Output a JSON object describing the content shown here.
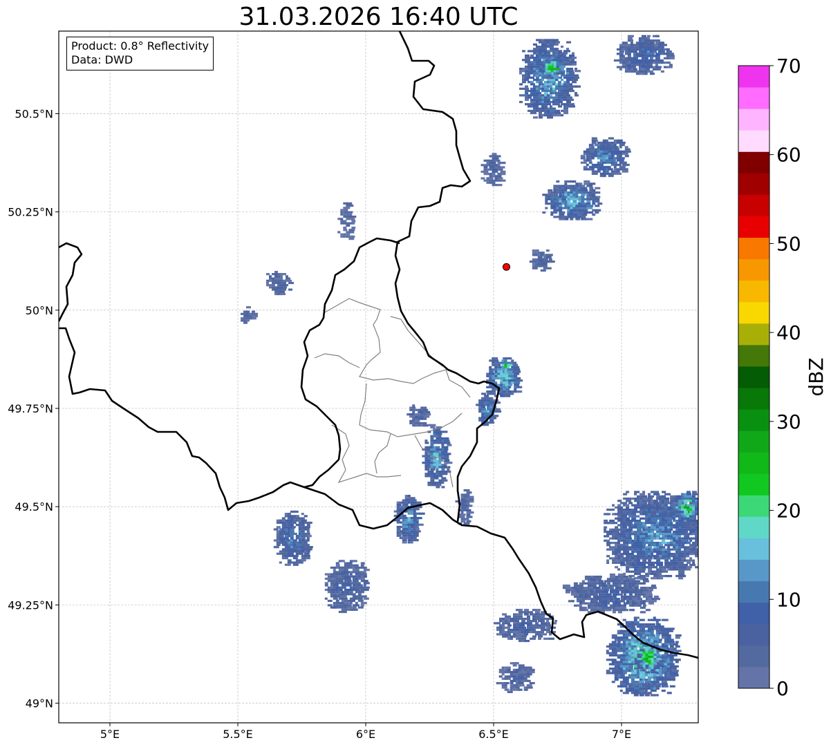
{
  "title": "31.03.2026 16:40 UTC",
  "info_box": {
    "product": "Product: 0.8° Reflectivity",
    "data_source": "Data: DWD"
  },
  "axes": {
    "lon_range": [
      4.8,
      7.3
    ],
    "lat_range": [
      48.95,
      50.71
    ],
    "x_ticks": [
      {
        "value": 5.0,
        "label": "5°E"
      },
      {
        "value": 5.5,
        "label": "5.5°E"
      },
      {
        "value": 6.0,
        "label": "6°E"
      },
      {
        "value": 6.5,
        "label": "6.5°E"
      },
      {
        "value": 7.0,
        "label": "7°E"
      }
    ],
    "y_ticks": [
      {
        "value": 49.0,
        "label": "49°N"
      },
      {
        "value": 49.25,
        "label": "49.25°N"
      },
      {
        "value": 49.5,
        "label": "49.5°N"
      },
      {
        "value": 49.75,
        "label": "49.75°N"
      },
      {
        "value": 50.0,
        "label": "50°N"
      },
      {
        "value": 50.25,
        "label": "50.25°N"
      },
      {
        "value": 50.5,
        "label": "50.5°N"
      }
    ],
    "grid": true
  },
  "colorbar": {
    "unit": "dBZ",
    "min": 0,
    "max": 70,
    "tick_labels": [
      "0",
      "10",
      "20",
      "30",
      "40",
      "50",
      "60",
      "70"
    ],
    "colors": [
      "#6474a8",
      "#536aa0",
      "#4a62a0",
      "#4060a8",
      "#4878b0",
      "#5898c8",
      "#68c0dc",
      "#60d8c8",
      "#3cd878",
      "#10c820",
      "#10b818",
      "#10a818",
      "#0a9010",
      "#087808",
      "#045c04",
      "#447808",
      "#a8b008",
      "#f8d800",
      "#f8b800",
      "#f89800",
      "#f87800",
      "#e80000",
      "#c80000",
      "#a00000",
      "#800000",
      "#ffdcff",
      "#ffb4ff",
      "#ff6cff",
      "#ee34ee"
    ]
  },
  "marker": {
    "lon": 6.55,
    "lat": 50.11,
    "color": "#ff0000"
  },
  "chart_data": {
    "type": "heatmap",
    "title": "31.03.2026 16:40 UTC",
    "xlabel": "",
    "ylabel": "",
    "xlim": [
      4.8,
      7.3
    ],
    "ylim": [
      48.95,
      50.71
    ],
    "colorbar_label": "dBZ",
    "colorbar_range": [
      0,
      70
    ],
    "echoes": [
      {
        "lon": 6.71,
        "lat": 50.59,
        "rx": 0.11,
        "ry": 0.1,
        "dbz": 14
      },
      {
        "lon": 7.08,
        "lat": 50.65,
        "rx": 0.11,
        "ry": 0.05,
        "dbz": 9
      },
      {
        "lon": 6.93,
        "lat": 50.39,
        "rx": 0.09,
        "ry": 0.05,
        "dbz": 12
      },
      {
        "lon": 6.8,
        "lat": 50.28,
        "rx": 0.11,
        "ry": 0.05,
        "dbz": 14
      },
      {
        "lon": 6.49,
        "lat": 50.36,
        "rx": 0.04,
        "ry": 0.04,
        "dbz": 6
      },
      {
        "lon": 6.68,
        "lat": 50.13,
        "rx": 0.04,
        "ry": 0.03,
        "dbz": 5
      },
      {
        "lon": 5.65,
        "lat": 50.07,
        "rx": 0.05,
        "ry": 0.03,
        "dbz": 5
      },
      {
        "lon": 5.53,
        "lat": 49.99,
        "rx": 0.03,
        "ry": 0.02,
        "dbz": 4
      },
      {
        "lon": 5.92,
        "lat": 50.23,
        "rx": 0.03,
        "ry": 0.05,
        "dbz": 4
      },
      {
        "lon": 6.53,
        "lat": 49.83,
        "rx": 0.07,
        "ry": 0.05,
        "dbz": 16
      },
      {
        "lon": 6.47,
        "lat": 49.75,
        "rx": 0.04,
        "ry": 0.04,
        "dbz": 12
      },
      {
        "lon": 6.27,
        "lat": 49.63,
        "rx": 0.05,
        "ry": 0.08,
        "dbz": 14
      },
      {
        "lon": 6.16,
        "lat": 49.47,
        "rx": 0.05,
        "ry": 0.06,
        "dbz": 12
      },
      {
        "lon": 6.2,
        "lat": 49.73,
        "rx": 0.04,
        "ry": 0.03,
        "dbz": 6
      },
      {
        "lon": 6.38,
        "lat": 49.5,
        "rx": 0.03,
        "ry": 0.05,
        "dbz": 5
      },
      {
        "lon": 5.71,
        "lat": 49.42,
        "rx": 0.07,
        "ry": 0.07,
        "dbz": 10
      },
      {
        "lon": 5.92,
        "lat": 49.3,
        "rx": 0.08,
        "ry": 0.07,
        "dbz": 7
      },
      {
        "lon": 6.62,
        "lat": 49.2,
        "rx": 0.12,
        "ry": 0.04,
        "dbz": 6
      },
      {
        "lon": 6.58,
        "lat": 49.07,
        "rx": 0.07,
        "ry": 0.04,
        "dbz": 5
      },
      {
        "lon": 7.13,
        "lat": 49.43,
        "rx": 0.2,
        "ry": 0.11,
        "dbz": 12
      },
      {
        "lon": 6.95,
        "lat": 49.28,
        "rx": 0.18,
        "ry": 0.05,
        "dbz": 7
      },
      {
        "lon": 7.08,
        "lat": 49.12,
        "rx": 0.14,
        "ry": 0.1,
        "dbz": 18
      },
      {
        "lon": 7.25,
        "lat": 49.5,
        "rx": 0.05,
        "ry": 0.04,
        "dbz": 22
      },
      {
        "lon": 6.72,
        "lat": 50.62,
        "rx": 0.04,
        "ry": 0.03,
        "dbz": 24
      },
      {
        "lon": 6.54,
        "lat": 49.86,
        "rx": 0.02,
        "ry": 0.02,
        "dbz": 24
      },
      {
        "lon": 7.1,
        "lat": 49.12,
        "rx": 0.05,
        "ry": 0.04,
        "dbz": 24
      }
    ]
  }
}
